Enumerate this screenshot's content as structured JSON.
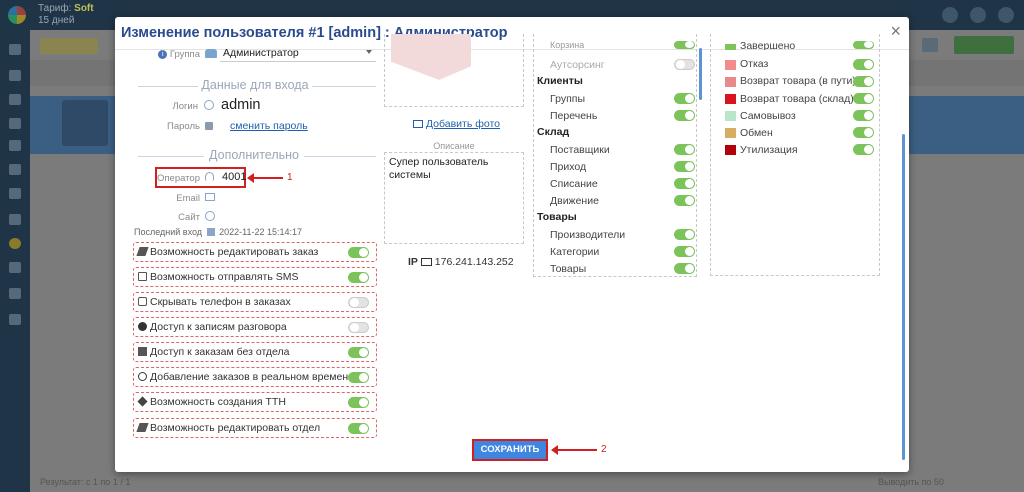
{
  "background": {
    "tariff_label": "Тариф:",
    "tariff_value": "Soft",
    "tariff_days": "15 дней",
    "footer_left": "Результат: с 1 по 1 / 1",
    "footer_right": "Выводить по 50"
  },
  "modal": {
    "title": "Изменение пользователя #1 [admin] : Администратор",
    "close": "×",
    "group_label": "Группа",
    "group_value": "Администратор",
    "login_section": "Данные для входа",
    "login_label": "Логин",
    "login_value": "admin",
    "password_label": "Пароль",
    "password_link": "сменить пароль",
    "extra_section": "Дополнительно",
    "operator_label": "Оператор",
    "operator_value": "4001",
    "email_label": "Email",
    "site_label": "Сайт",
    "last_login_label": "Последний вход",
    "last_login_value": "2022-11-22 15:14:17",
    "add_photo": "Добавить фото",
    "description_label": "Описание",
    "description_value": "Супер пользователь системы",
    "ip_label": "IP",
    "ip_value": "176.241.143.252",
    "save_label": "СОХРАНИТЬ",
    "annotation_1": "1",
    "annotation_2": "2"
  },
  "permissions": [
    {
      "label": "Возможность редактировать заказ",
      "icon": "pencil-icon",
      "on": true
    },
    {
      "label": "Возможность отправлять SMS",
      "icon": "sms-icon",
      "on": true
    },
    {
      "label": "Скрывать телефон в заказах",
      "icon": "phone-icon",
      "on": false
    },
    {
      "label": "Доступ к записям разговора",
      "icon": "play-icon",
      "on": false
    },
    {
      "label": "Доступ к заказам без отдела",
      "icon": "building-icon",
      "on": true
    },
    {
      "label": "Добавление заказов в реальном времени",
      "icon": "clock-icon",
      "on": true
    },
    {
      "label": "Возможность создания ТТН",
      "icon": "dropbox-icon",
      "on": true
    },
    {
      "label": "Возможность редактировать отдел",
      "icon": "pencil-icon",
      "on": true
    }
  ],
  "rights": {
    "top_partial": "Корзина",
    "top_outsourcing": "Аутсорсинг",
    "clients": "Клиенты",
    "clients_items": [
      "Группы",
      "Перечень"
    ],
    "warehouse": "Склад",
    "warehouse_items": [
      "Поставщики",
      "Приход",
      "Списание",
      "Движение"
    ],
    "goods": "Товары",
    "goods_items": [
      "Производители",
      "Категории",
      "Товары"
    ]
  },
  "statuses": [
    {
      "label": "Завершено",
      "color": "#7dc558",
      "on": true
    },
    {
      "label": "Отказ",
      "color": "#f28b8b",
      "on": true
    },
    {
      "label": "Возврат товара (в пути)",
      "color": "#e88a8a",
      "on": true
    },
    {
      "label": "Возврат товара (склад)",
      "color": "#d9141f",
      "on": true
    },
    {
      "label": "Самовывоз",
      "color": "#b9e5c8",
      "on": true
    },
    {
      "label": "Обмен",
      "color": "#d6ad63",
      "on": true
    },
    {
      "label": "Утилизация",
      "color": "#b3000a",
      "on": true
    }
  ]
}
